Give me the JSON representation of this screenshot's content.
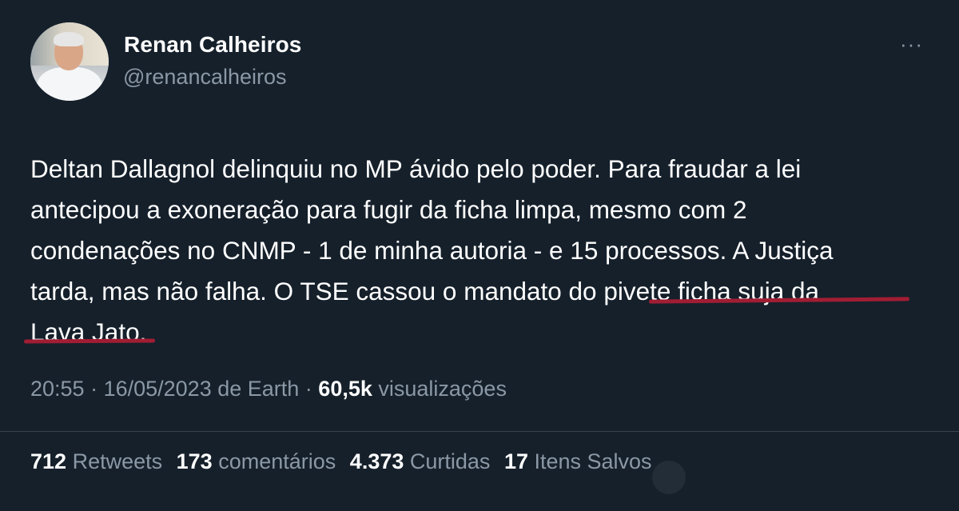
{
  "author": {
    "name": "Renan Calheiros",
    "handle": "@renancalheiros"
  },
  "more_glyph": "···",
  "tweet": {
    "lines": [
      "Deltan Dallagnol delinquiu no MP ávido pelo poder. Para fraudar a lei",
      "antecipou a exoneração para fugir da ficha limpa, mesmo com 2",
      "condenações no CNMP - 1 de minha autoria - e 15 processos. A Justiça",
      "tarda, mas não falha. O TSE cassou o mandato do pivete ficha suja da",
      "Lava Jato."
    ]
  },
  "meta": {
    "time": "20:55",
    "sep1": " · ",
    "date": "16/05/2023",
    "source": " de Earth",
    "sep2": " · ",
    "views_count": "60,5k",
    "views_label": " visualizações"
  },
  "stats": {
    "retweets_count": "712",
    "retweets_label": " Retweets",
    "comments_count": "173",
    "comments_label": " comentários",
    "likes_count": "4.373",
    "likes_label": " Curtidas",
    "saves_count": "17",
    "saves_label": " Itens Salvos"
  },
  "colors": {
    "background": "#15202b",
    "text": "#ffffff",
    "muted": "#8b98a5",
    "annotation_underline": "#a11d33"
  }
}
